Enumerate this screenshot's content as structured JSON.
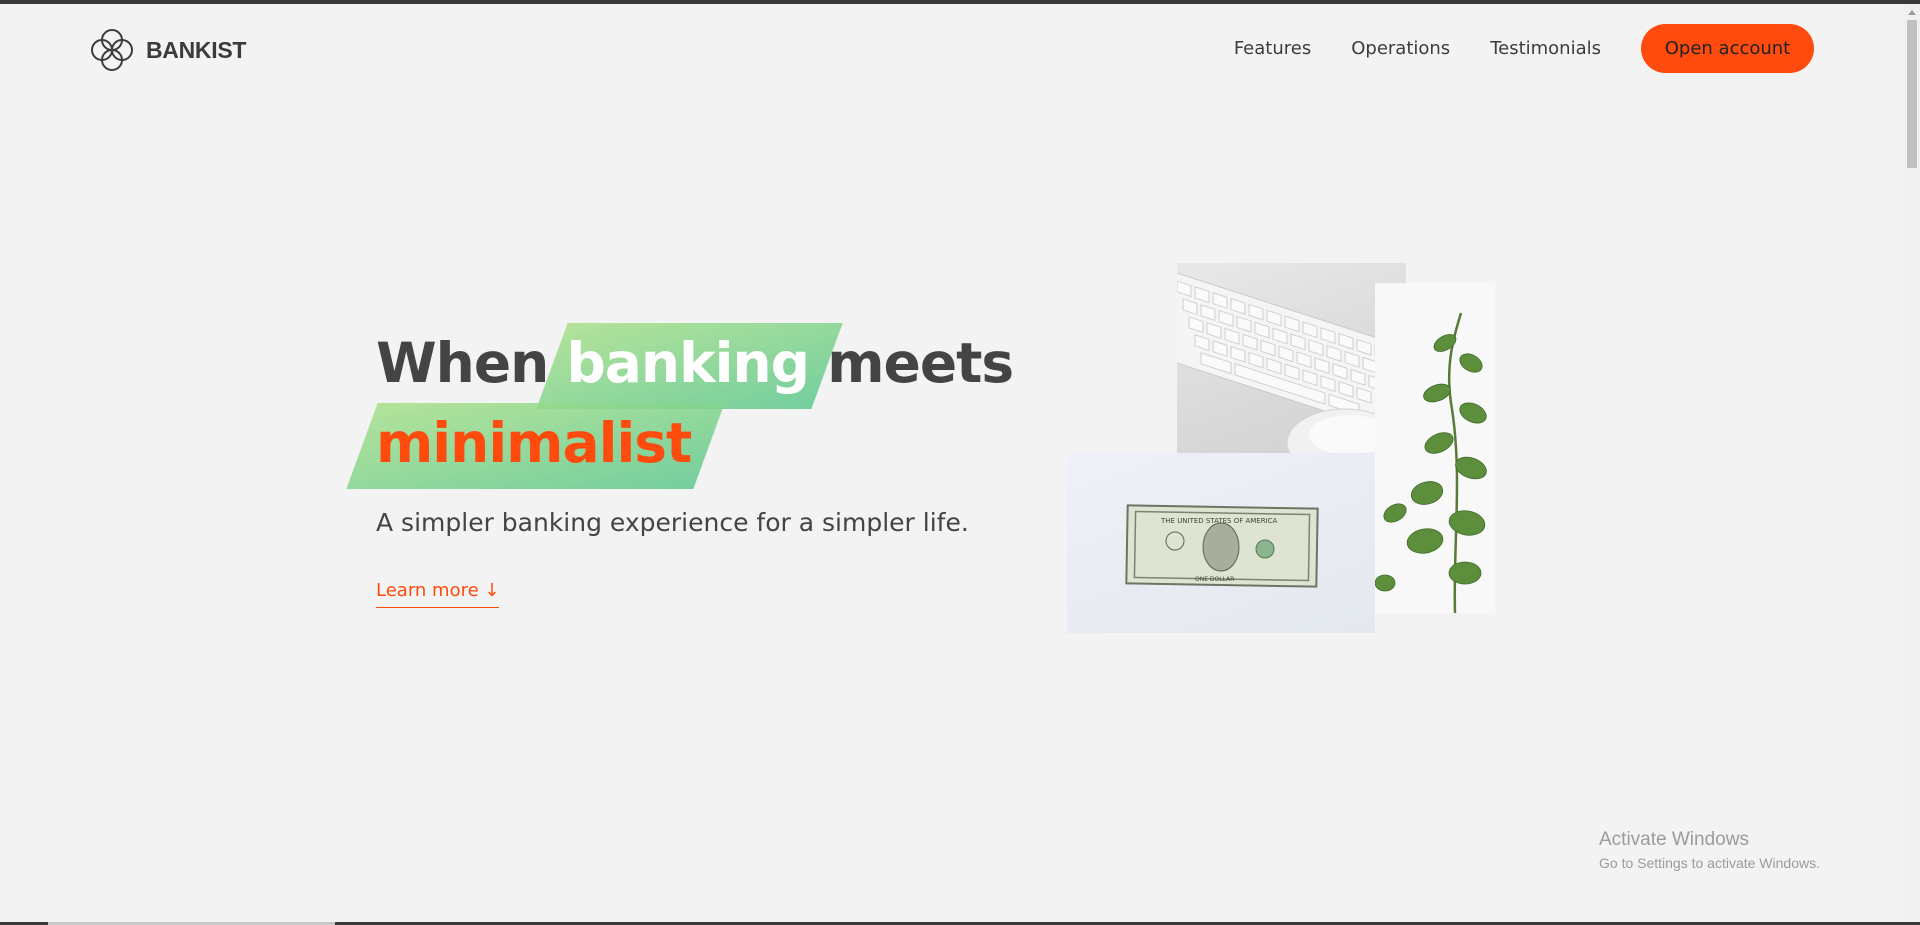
{
  "brand": {
    "name": "BANKIST",
    "logo_icon": "four-circles-logo-icon"
  },
  "nav": {
    "items": [
      {
        "label": "Features"
      },
      {
        "label": "Operations"
      },
      {
        "label": "Testimonials"
      }
    ],
    "cta_label": "Open account"
  },
  "hero": {
    "title_word1": "When",
    "title_highlight1": "banking",
    "title_word2": "meets",
    "title_highlight2": "minimalist",
    "subtitle": "A simpler banking experience for a simpler life.",
    "learn_more": "Learn more ↓"
  },
  "images": {
    "keyboard": "keyboard-and-mouse-photo",
    "dollar": "dollar-bill-photo",
    "plant": "eucalyptus-plant-photo"
  },
  "watermark": {
    "line1": "Activate Windows",
    "line2": "Go to Settings to activate Windows."
  },
  "colors": {
    "accent": "#ff4b0e",
    "highlight_start": "#a8e08a",
    "highlight_end": "#5ec88f",
    "background": "#f3f3f3",
    "text": "#444444"
  }
}
